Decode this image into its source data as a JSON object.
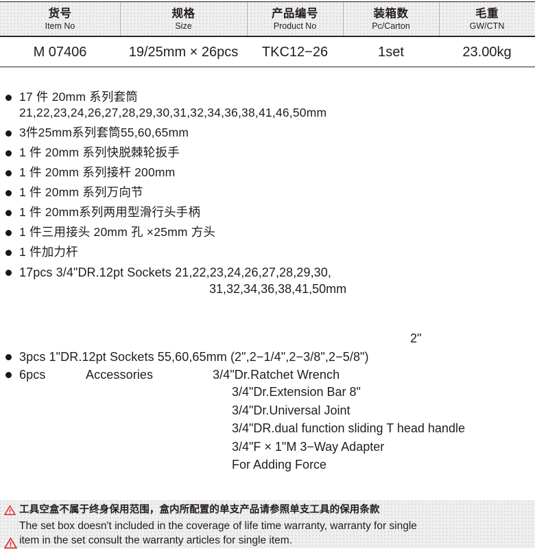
{
  "table": {
    "columns": [
      {
        "cn": "货号",
        "en": "Item No",
        "value": "M 07406"
      },
      {
        "cn": "规格",
        "en": "Size",
        "value": "19/25mm × 26pcs"
      },
      {
        "cn": "产品编号",
        "en": "Product No",
        "value": "TKC12−26"
      },
      {
        "cn": "装箱数",
        "en": "Pc/Carton",
        "value": "1set"
      },
      {
        "cn": "毛重",
        "en": "GW/CTN",
        "value": "23.00kg"
      }
    ]
  },
  "chinese_items": [
    {
      "line1": "17 件 20mm 系列套筒",
      "line2": "21,22,23,24,26,27,28,29,30,31,32,34,36,38,41,46,50mm"
    },
    {
      "line1": "3件25mm系列套筒55,60,65mm"
    },
    {
      "line1": "1 件 20mm 系列快脱棘轮扳手"
    },
    {
      "line1": "1 件 20mm 系列接杆 200mm"
    },
    {
      "line1": "1 件 20mm 系列万向节"
    },
    {
      "line1": "1 件 20mm系列两用型滑行头手柄"
    },
    {
      "line1": "1 件三用接头 20mm 孔 ×25mm 方头"
    },
    {
      "line1": "1 件加力杆"
    }
  ],
  "english_items": {
    "sockets_17": {
      "line1": "17pcs  3/4\"DR.12pt Sockets    21,22,23,24,26,27,28,29,30,",
      "line2": "31,32,34,36,38,41,50mm"
    },
    "superscript_note": "2\"",
    "sockets_3": "3pcs  1\"DR.12pt Sockets  55,60,65mm (2\",2−1/4\",2−3/8\",2−5/8\")",
    "accessories": {
      "count": "6pcs",
      "label": "Accessories",
      "first": "3/4\"Dr.Ratchet Wrench",
      "rest": [
        "3/4\"Dr.Extension Bar 8\"",
        "3/4\"Dr.Universal Joint",
        "3/4\"DR.dual function sliding T head handle",
        "3/4\"F × 1\"M 3−Way Adapter",
        "For Adding Force"
      ]
    }
  },
  "warning": {
    "cn": "工具空盒不属于终身保用范围，盒内所配置的单支产品请参照单支工具的保用条款",
    "en_line1": "The set box doesn't included in the coverage of life time warranty, warranty for single",
    "en_line2": "item in the set consult the warranty articles for single item.",
    "icon_color": "#e02020"
  }
}
